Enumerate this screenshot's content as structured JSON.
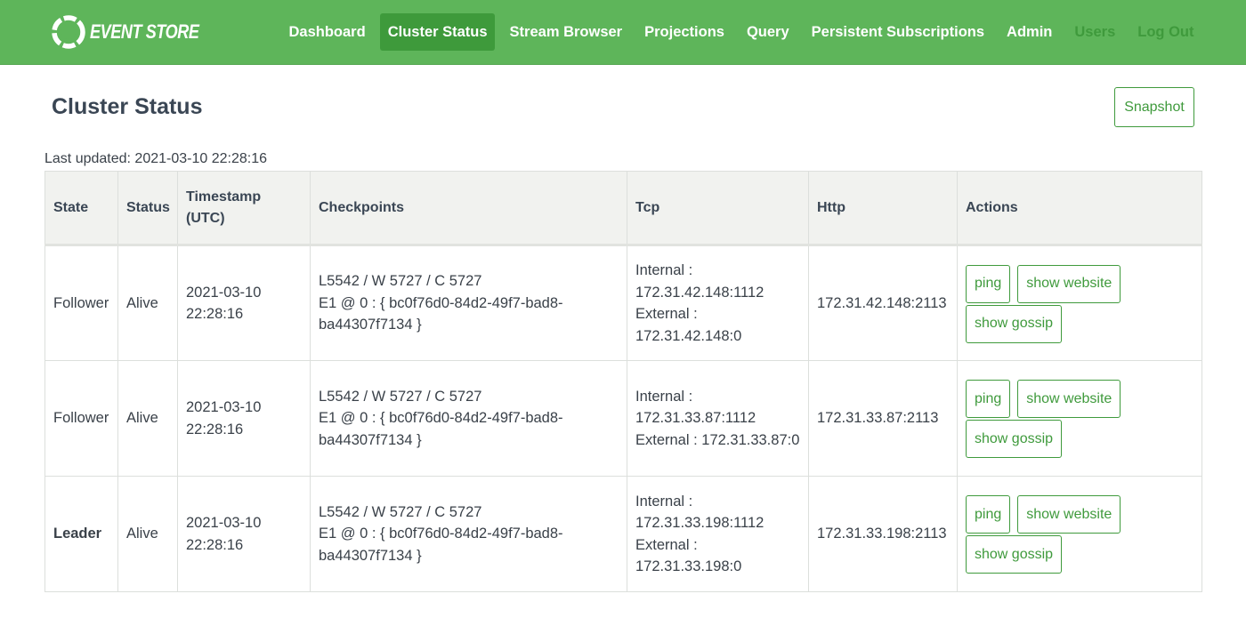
{
  "brand": {
    "name": "EVENT STORE"
  },
  "nav": {
    "items": [
      {
        "label": "Dashboard",
        "state": "normal"
      },
      {
        "label": "Cluster Status",
        "state": "active"
      },
      {
        "label": "Stream Browser",
        "state": "normal"
      },
      {
        "label": "Projections",
        "state": "normal"
      },
      {
        "label": "Query",
        "state": "normal"
      },
      {
        "label": "Persistent Subscriptions",
        "state": "normal"
      },
      {
        "label": "Admin",
        "state": "normal"
      },
      {
        "label": "Users",
        "state": "muted"
      },
      {
        "label": "Log Out",
        "state": "muted"
      }
    ]
  },
  "page": {
    "title": "Cluster Status",
    "snapshot_label": "Snapshot",
    "last_updated": "Last updated: 2021-03-10 22:28:16"
  },
  "table": {
    "headers": [
      "State",
      "Status",
      "Timestamp (UTC)",
      "Checkpoints",
      "Tcp",
      "Http",
      "Actions"
    ],
    "rows": [
      {
        "state": "Follower",
        "status": "Alive",
        "timestamp": "2021-03-10 22:28:16",
        "checkpoints_1": "L5542 / W 5727 / C 5727",
        "checkpoints_2": "E1 @ 0 : { bc0f76d0-84d2-49f7-bad8-ba44307f7134 }",
        "tcp_internal": "Internal : 172.31.42.148:1112",
        "tcp_external": "External : 172.31.42.148:0",
        "http": "172.31.42.148:2113",
        "actions": [
          "ping",
          "show website",
          "show gossip"
        ]
      },
      {
        "state": "Follower",
        "status": "Alive",
        "timestamp": "2021-03-10 22:28:16",
        "checkpoints_1": "L5542 / W 5727 / C 5727",
        "checkpoints_2": "E1 @ 0 : { bc0f76d0-84d2-49f7-bad8-ba44307f7134 }",
        "tcp_internal": "Internal : 172.31.33.87:1112",
        "tcp_external": "External : 172.31.33.87:0",
        "http": "172.31.33.87:2113",
        "actions": [
          "ping",
          "show website",
          "show gossip"
        ]
      },
      {
        "state": "Leader",
        "status": "Alive",
        "timestamp": "2021-03-10 22:28:16",
        "checkpoints_1": "L5542 / W 5727 / C 5727",
        "checkpoints_2": "E1 @ 0 : { bc0f76d0-84d2-49f7-bad8-ba44307f7134 }",
        "tcp_internal": "Internal : 172.31.33.198:1112",
        "tcp_external": "External : 172.31.33.198:0",
        "http": "172.31.33.198:2113",
        "actions": [
          "ping",
          "show website",
          "show gossip"
        ]
      }
    ]
  },
  "colors": {
    "navbar": "#5eb55a",
    "nav_active": "#3e9a3b",
    "accent": "#3f9a3c",
    "table_header_bg": "#f1f2ef"
  }
}
